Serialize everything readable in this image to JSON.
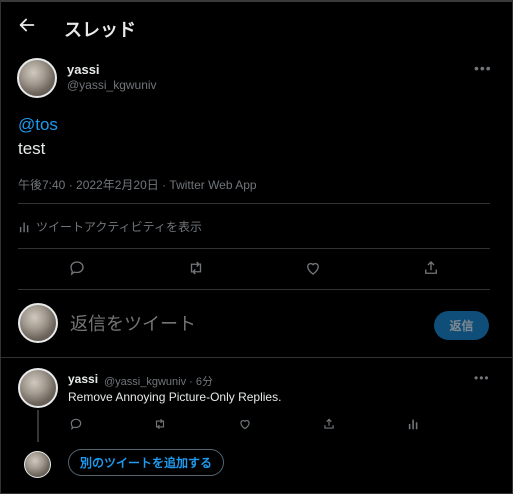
{
  "header": {
    "title": "スレッド",
    "back_icon": "back-arrow-icon"
  },
  "tweet": {
    "author_name": "yassi",
    "author_handle": "@yassi_kgwuniv",
    "mention": "@tos",
    "text": "test",
    "meta": "午後7:40 · 2022年2月20日 · Twitter Web App",
    "activity_label": "ツイートアクティビティを表示",
    "actions": [
      "reply-icon",
      "retweet-icon",
      "like-icon",
      "share-icon"
    ]
  },
  "compose": {
    "placeholder": "返信をツイート",
    "reply_label": "返信"
  },
  "reply": {
    "author_name": "yassi",
    "author_handle": "@yassi_kgwuniv · 6分",
    "text": "Remove Annoying Picture-Only Replies.",
    "actions": [
      "reply-icon",
      "retweet-icon",
      "like-icon",
      "share-icon",
      "analytics-icon"
    ]
  },
  "add_tweet_label": "別のツイートを追加する",
  "colors": {
    "accent": "#1d9bf0",
    "background": "#000000",
    "muted": "#71767b"
  }
}
